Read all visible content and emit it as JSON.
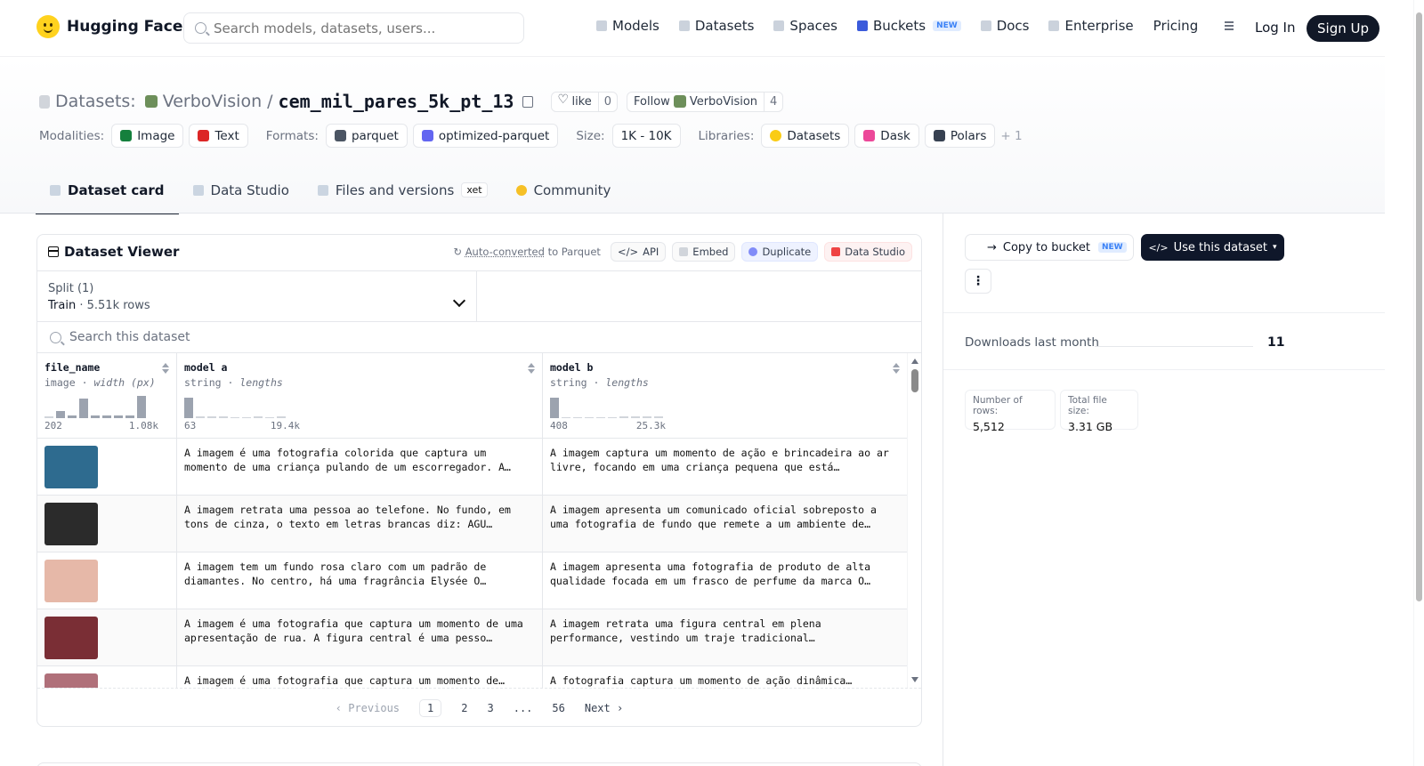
{
  "nav": {
    "brand": "Hugging Face",
    "search_placeholder": "Search models, datasets, users...",
    "menu": [
      {
        "label": "Models",
        "icon": "model-cube-icon"
      },
      {
        "label": "Datasets",
        "icon": "database-icon"
      },
      {
        "label": "Spaces",
        "icon": "spaces-grid-icon"
      },
      {
        "label": "Buckets",
        "icon": "bucket-icon",
        "badge": "NEW"
      },
      {
        "label": "Docs",
        "icon": "book-icon"
      },
      {
        "label": "Enterprise",
        "icon": "enterprise-icon"
      },
      {
        "label": "Pricing"
      }
    ],
    "login": "Log In",
    "signup": "Sign Up"
  },
  "header": {
    "crumb_label": "Datasets:",
    "org": "VerboVision",
    "separator": "/",
    "dataset": "cem_mil_pares_5k_pt_13",
    "like_label": "like",
    "like_count": "0",
    "follow_label": "Follow",
    "follow_org": "VerboVision",
    "follow_count": "4",
    "modalities_label": "Modalities:",
    "modalities": [
      "Image",
      "Text"
    ],
    "formats_label": "Formats:",
    "formats": [
      "parquet",
      "optimized-parquet"
    ],
    "size_label": "Size:",
    "size": "1K - 10K",
    "libraries_label": "Libraries:",
    "libraries": [
      "Datasets",
      "Dask",
      "Polars"
    ],
    "libraries_more": "+ 1"
  },
  "tabs": [
    {
      "label": "Dataset card",
      "active": true
    },
    {
      "label": "Data Studio"
    },
    {
      "label": "Files and versions",
      "badge": "xet"
    },
    {
      "label": "Community"
    }
  ],
  "viewer": {
    "title": "Dataset Viewer",
    "auto_converted": "Auto-converted",
    "auto_converted_suffix": "to Parquet",
    "api": "API",
    "embed": "Embed",
    "duplicate": "Duplicate",
    "data_studio": "Data Studio",
    "split_label": "Split (1)",
    "split_name": "Train",
    "split_sep": "·",
    "split_rows": "5.51k rows",
    "search_placeholder": "Search this dataset",
    "columns": [
      {
        "name": "file_name",
        "type": "image",
        "meta": "width (px)",
        "min": "202",
        "max": "1.08k",
        "hist": [
          0.05,
          0.3,
          0.1,
          0.85,
          0.1,
          0.1,
          0.1,
          0.1,
          0.95
        ]
      },
      {
        "name": "model a",
        "type": "string",
        "meta": "lengths",
        "min": "63",
        "max": "19.4k",
        "hist": [
          0.9,
          0.05,
          0.05,
          0.05,
          0,
          0,
          0.05,
          0,
          0.05
        ]
      },
      {
        "name": "model b",
        "type": "string",
        "meta": "lengths",
        "min": "408",
        "max": "25.3k",
        "hist": [
          0.9,
          0,
          0,
          0,
          0,
          0,
          0.05,
          0.05,
          0.05,
          0.05
        ]
      }
    ],
    "type_sep": "·",
    "rows": [
      {
        "a": "A imagem é uma fotografia colorida que captura um momento de uma criança pulando de um escorregador. A…",
        "b": "A imagem captura um momento de ação e brincadeira ao ar livre, focando em uma criança pequena que está…",
        "thumb": "#2e6b8f"
      },
      {
        "a": "A imagem retrata uma pessoa ao telefone. No fundo, em tons de cinza, o texto em letras brancas diz: AGU…",
        "b": "A imagem apresenta um comunicado oficial sobreposto a uma fotografia de fundo que remete a um ambiente de…",
        "thumb": "#2b2b2b"
      },
      {
        "a": "A imagem tem um fundo rosa claro com um padrão de diamantes. No centro, há uma fragrância Elysée O…",
        "b": "A imagem apresenta uma fotografia de produto de alta qualidade focada em um frasco de perfume da marca O…",
        "thumb": "#e6b8a8"
      },
      {
        "a": "A imagem é uma fotografia que captura um momento de uma apresentação de rua. A figura central é uma pesso…",
        "b": "A imagem retrata uma figura central em plena performance, vestindo um traje tradicional…",
        "thumb": "#7a2e35"
      },
      {
        "a": "A imagem é uma fotografia que captura um momento de…",
        "b": "A fotografia captura um momento de ação dinâmica…",
        "thumb": "#b0707a"
      }
    ],
    "pager": {
      "prev": "Previous",
      "pages": [
        "1",
        "2",
        "3",
        "...",
        "56"
      ],
      "next": "Next"
    }
  },
  "sidebar": {
    "copy_bucket": "Copy to bucket",
    "copy_bucket_badge": "NEW",
    "use_dataset": "Use this dataset",
    "more": "⋮",
    "downloads_label": "Downloads last month",
    "downloads": "11",
    "rows_label": "Number of rows:",
    "rows_value": "5,512",
    "size_label": "Total file size:",
    "size_value": "3.31 GB"
  }
}
